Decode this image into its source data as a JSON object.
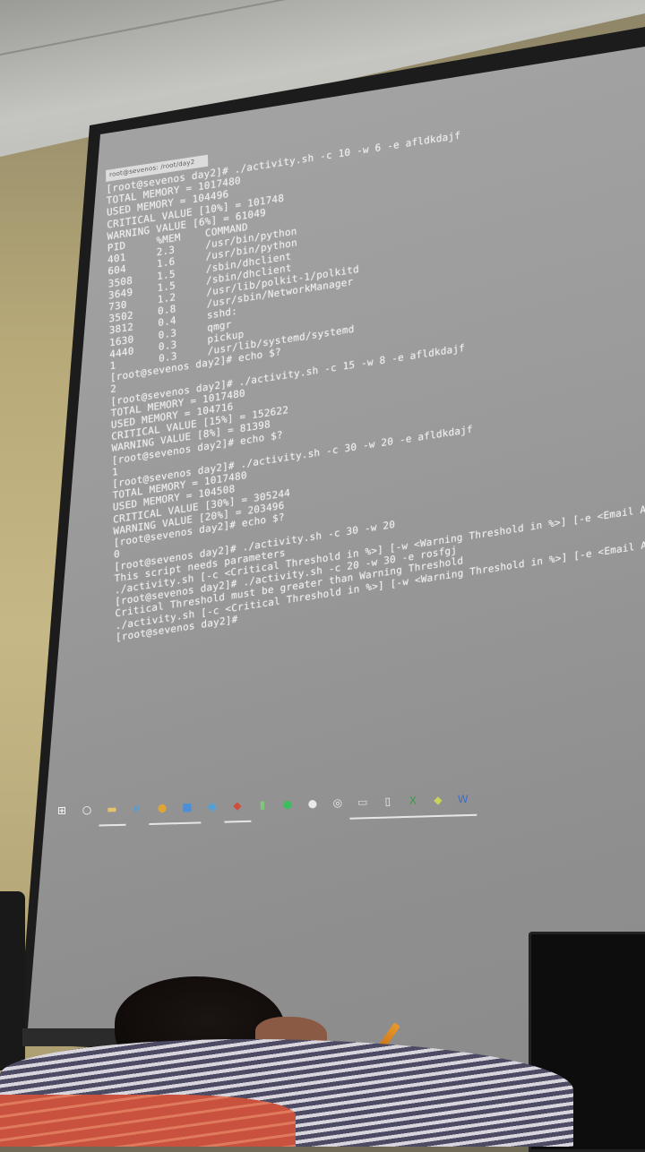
{
  "terminal": {
    "window_title": "root@sevenos: /root/day2",
    "lines": [
      "[root@sevenos day2]# ./activity.sh -c 10 -w 6 -e afldkdajf",
      "TOTAL MEMORY = 1017480",
      "USED MEMORY = 104496",
      "CRITICAL VALUE [10%] = 101748",
      "WARNING VALUE [6%] = 61049",
      "PID     %MEM    COMMAND",
      "401     2.3     /usr/bin/python",
      "604     1.6     /usr/bin/python",
      "3508    1.5     /sbin/dhclient",
      "3649    1.5     /sbin/dhclient",
      "730     1.2     /usr/lib/polkit-1/polkitd",
      "3502    0.8     /usr/sbin/NetworkManager",
      "3812    0.4     sshd:",
      "1630    0.3     qmgr",
      "4440    0.3     pickup",
      "1       0.3     /usr/lib/systemd/systemd",
      "[root@sevenos day2]# echo $?",
      "2",
      "[root@sevenos day2]# ./activity.sh -c 15 -w 8 -e afldkdajf",
      "TOTAL MEMORY = 1017480",
      "USED MEMORY = 104716",
      "CRITICAL VALUE [15%] = 152622",
      "WARNING VALUE [8%] = 81398",
      "[root@sevenos day2]# echo $?",
      "1",
      "[root@sevenos day2]# ./activity.sh -c 30 -w 20 -e afldkdajf",
      "TOTAL MEMORY = 1017480",
      "USED MEMORY = 104508",
      "CRITICAL VALUE [30%] = 305244",
      "WARNING VALUE [20%] = 203496",
      "[root@sevenos day2]# echo $?",
      "0",
      "[root@sevenos day2]# ./activity.sh -c 30 -w 20",
      "This script needs parameters",
      "./activity.sh [-c <Critical Threshold in %>] [-w <Warning Threshold in %>] [-e <Email Addre",
      "[root@sevenos day2]# ./activity.sh -c 20 -w 30 -e rosfgj",
      "Critical Threshold must be greater than Warning Threshold",
      "./activity.sh [-c <Critical Threshold in %>] [-w <Warning Threshold in %>] [-e <Email Addres",
      "[root@sevenos day2]# "
    ]
  },
  "taskbar": {
    "icons": [
      {
        "name": "windows-start-icon",
        "glyph": "⊞",
        "color": "#ffffff",
        "active": false
      },
      {
        "name": "search-circle-icon",
        "glyph": "○",
        "color": "#ffffff",
        "active": false
      },
      {
        "name": "file-explorer-icon",
        "glyph": "▬",
        "color": "#e2c36b",
        "active": true
      },
      {
        "name": "edge-browser-icon",
        "glyph": "e",
        "color": "#3fa0e8",
        "active": false
      },
      {
        "name": "chrome-icon",
        "glyph": "●",
        "color": "#e0a534",
        "active": true
      },
      {
        "name": "store-icon",
        "glyph": "■",
        "color": "#4a8fd8",
        "active": true
      },
      {
        "name": "browser-blue-icon",
        "glyph": "◉",
        "color": "#4aa3e0",
        "active": false
      },
      {
        "name": "app-red-icon",
        "glyph": "◆",
        "color": "#d24a3a",
        "active": true
      },
      {
        "name": "notepad-icon",
        "glyph": "▮",
        "color": "#7ec67a",
        "active": false
      },
      {
        "name": "spotify-icon",
        "glyph": "●",
        "color": "#3bbf5a",
        "active": false
      },
      {
        "name": "cloud-icon",
        "glyph": "●",
        "color": "#e9e9e9",
        "active": false
      },
      {
        "name": "settings-icon",
        "glyph": "◎",
        "color": "#f0f0f0",
        "active": false
      },
      {
        "name": "terminal-icon",
        "glyph": "▭",
        "color": "#dcdcdc",
        "active": true
      },
      {
        "name": "document-icon",
        "glyph": "▯",
        "color": "#f2f2f2",
        "active": true
      },
      {
        "name": "excel-icon",
        "glyph": "X",
        "color": "#3c9a4a",
        "active": true
      },
      {
        "name": "git-icon",
        "glyph": "◆",
        "color": "#c9d45a",
        "active": true
      },
      {
        "name": "word-icon",
        "glyph": "W",
        "color": "#3d6fc4",
        "active": true
      }
    ]
  }
}
